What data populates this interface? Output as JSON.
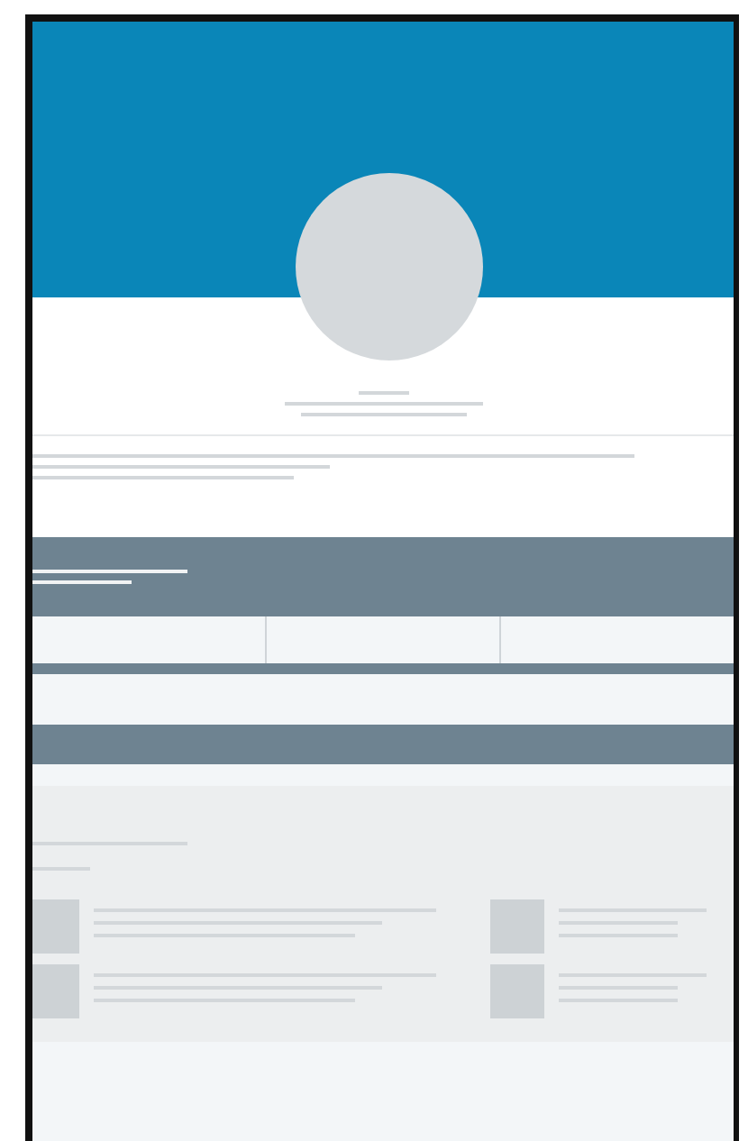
{
  "sections": [
    {
      "kind": "cover"
    },
    {
      "kind": "name"
    },
    {
      "kind": "about"
    },
    {
      "kind": "band"
    },
    {
      "kind": "stats"
    },
    {
      "kind": "strip"
    },
    {
      "kind": "gap"
    },
    {
      "kind": "bar"
    },
    {
      "kind": "grid"
    },
    {
      "kind": "footer"
    }
  ]
}
